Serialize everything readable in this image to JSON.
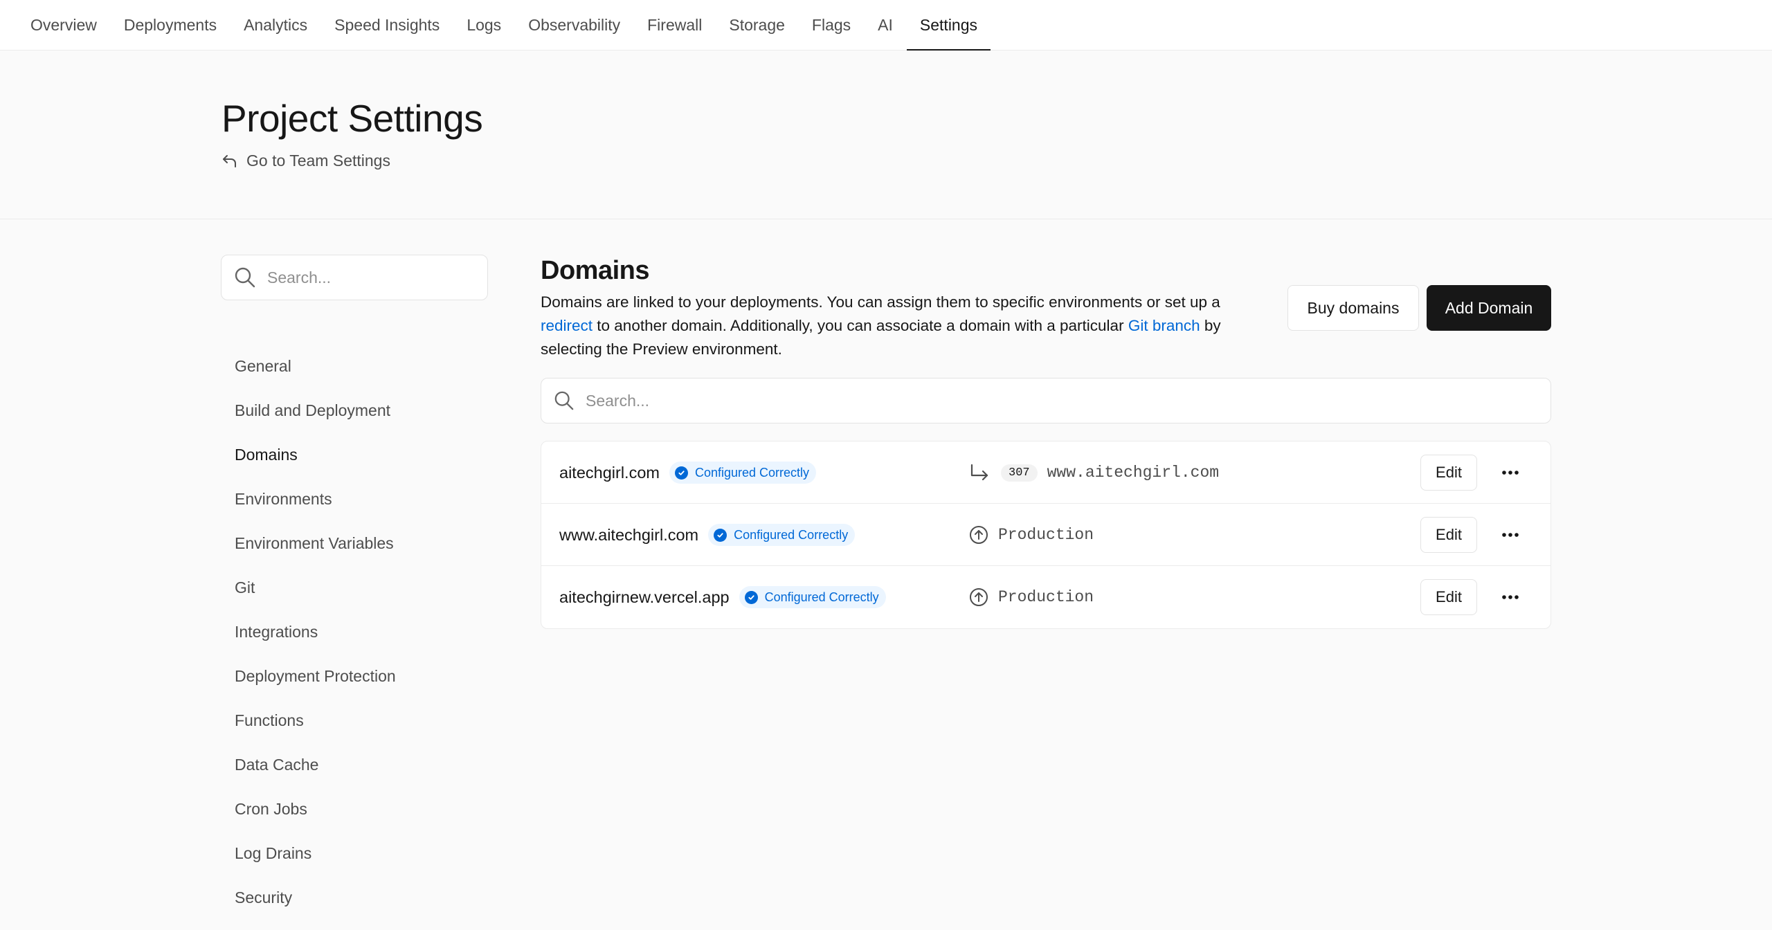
{
  "topnav": {
    "tabs": [
      "Overview",
      "Deployments",
      "Analytics",
      "Speed Insights",
      "Logs",
      "Observability",
      "Firewall",
      "Storage",
      "Flags",
      "AI",
      "Settings"
    ],
    "active": "Settings"
  },
  "header": {
    "title": "Project Settings",
    "back_link": "Go to Team Settings"
  },
  "sidebar": {
    "search_placeholder": "Search...",
    "items": [
      "General",
      "Build and Deployment",
      "Domains",
      "Environments",
      "Environment Variables",
      "Git",
      "Integrations",
      "Deployment Protection",
      "Functions",
      "Data Cache",
      "Cron Jobs",
      "Log Drains",
      "Security"
    ],
    "active": "Domains"
  },
  "main": {
    "title": "Domains",
    "description": {
      "part1": "Domains are linked to your deployments. You can assign them to specific environments or set up a ",
      "link1": "redirect",
      "part2": " to another domain. Additionally, you can associate a domain with a particular ",
      "link2": "Git branch",
      "part3": " by selecting the Preview environment."
    },
    "buy_button": "Buy domains",
    "add_button": "Add Domain",
    "search_placeholder": "Search...",
    "edit_label": "Edit",
    "domains": [
      {
        "name": "aitechgirl.com",
        "status": "Configured Correctly",
        "type": "redirect",
        "code": "307",
        "target": "www.aitechgirl.com"
      },
      {
        "name": "www.aitechgirl.com",
        "status": "Configured Correctly",
        "type": "environment",
        "target": "Production"
      },
      {
        "name": "aitechgirnew.vercel.app",
        "status": "Configured Correctly",
        "type": "environment",
        "target": "Production"
      }
    ]
  },
  "colors": {
    "accent_blue": "#0068d6",
    "badge_bg": "#ebf5ff",
    "primary_button": "#171717",
    "page_bg": "#fafafa"
  }
}
